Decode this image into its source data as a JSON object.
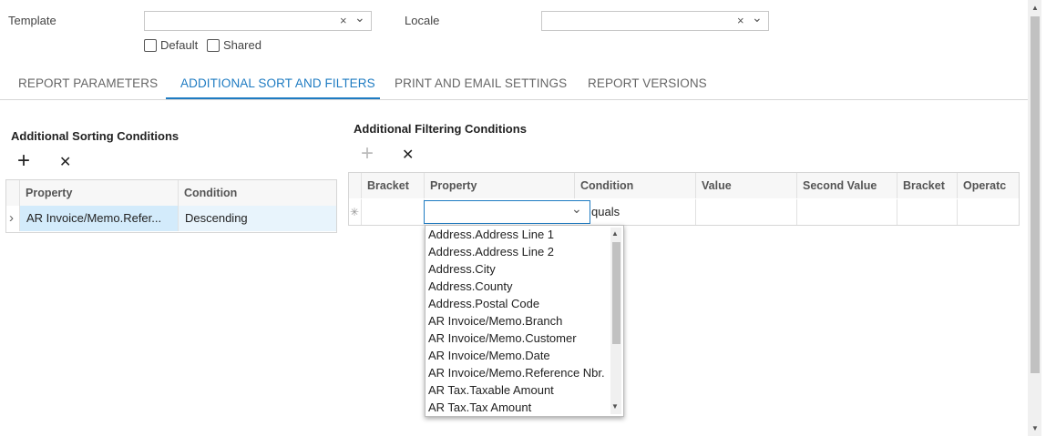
{
  "header": {
    "template_label": "Template",
    "template_value": "",
    "locale_label": "Locale",
    "locale_value": "",
    "clear_glyph": "×",
    "chevron_glyph": "⌄",
    "default_label": "Default",
    "shared_label": "Shared"
  },
  "tabs": [
    {
      "label": "REPORT PARAMETERS"
    },
    {
      "label": "ADDITIONAL SORT AND FILTERS"
    },
    {
      "label": "PRINT AND EMAIL SETTINGS"
    },
    {
      "label": "REPORT VERSIONS"
    }
  ],
  "sorting": {
    "title": "Additional Sorting Conditions",
    "add_glyph": "+",
    "remove_glyph": "✕",
    "columns": [
      "Property",
      "Condition"
    ],
    "rows": [
      {
        "expander": "›",
        "property": "AR Invoice/Memo.Refer...",
        "condition": "Descending"
      }
    ]
  },
  "filtering": {
    "title": "Additional Filtering Conditions",
    "add_glyph": "+",
    "remove_glyph": "✕",
    "columns": [
      "Bracket",
      "Property",
      "Condition",
      "Value",
      "Second Value",
      "Bracket",
      "Operatc"
    ],
    "new_row_glyph": "✳",
    "row_condition": "quals",
    "property_value": ""
  },
  "dropdown": {
    "items": [
      "Address.Address Line 1",
      "Address.Address Line 2",
      "Address.City",
      "Address.County",
      "Address.Postal Code",
      "AR Invoice/Memo.Branch",
      "AR Invoice/Memo.Customer",
      "AR Invoice/Memo.Date",
      "AR Invoice/Memo.Reference Nbr.",
      "AR Tax.Taxable Amount",
      "AR Tax.Tax Amount"
    ],
    "up_glyph": "▲",
    "down_glyph": "▼"
  }
}
